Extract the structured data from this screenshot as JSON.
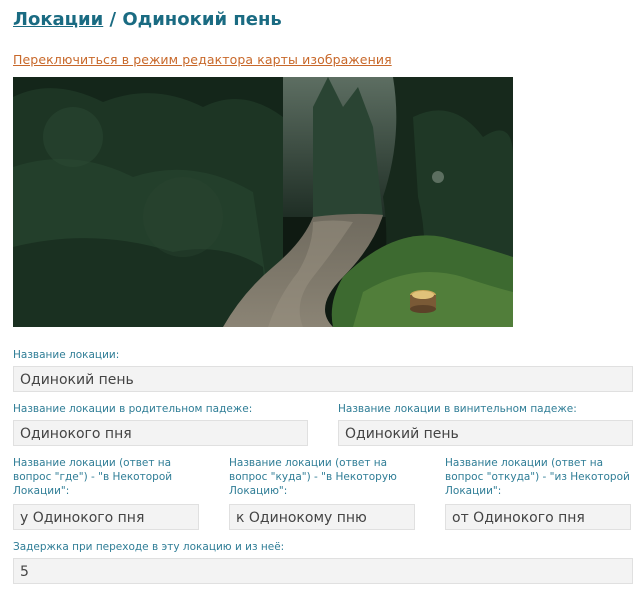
{
  "breadcrumb": {
    "parent_link": "Локации",
    "separator": " / ",
    "current": "Одинокий пень"
  },
  "switch_link": "Переключиться в режим редактора карты изображения",
  "image": {
    "icon": "forest-path-stump-image"
  },
  "form": {
    "name": {
      "label": "Название локации:",
      "value": "Одинокий пень"
    },
    "genitive": {
      "label": "Название локации в родительном падеже:",
      "value": "Одинокого пня"
    },
    "accusative": {
      "label": "Название локации в винительном падеже:",
      "value": "Одинокий пень"
    },
    "where": {
      "label": "Название локации (ответ на вопрос \"где\") - \"в Некоторой Локации\":",
      "value": "у Одинокого пня"
    },
    "whither": {
      "label": "Название локации (ответ на вопрос \"куда\") - \"в Некоторую Локацию\":",
      "value": "к Одинокому пню"
    },
    "whence": {
      "label": "Название локации (ответ на вопрос \"откуда\") - \"из Некоторой Локации\":",
      "value": "от Одинокого пня"
    },
    "delay": {
      "label": "Задержка при переходе в эту локацию и из неё:",
      "value": "5"
    }
  },
  "colors": {
    "accent": "#1a6b82",
    "link": "#c8682a",
    "label": "#2f7d96",
    "field_bg": "#f3f3f3"
  }
}
